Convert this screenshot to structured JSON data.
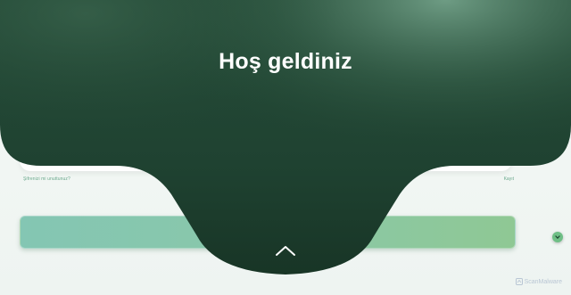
{
  "welcome": {
    "title": "Hoş geldiniz",
    "expand_icon": "chevron-up-icon"
  },
  "login": {
    "forgot_password": "Şifrenizi mi unuttunuz?",
    "signup": "Kayıt",
    "submit_label": ""
  },
  "help": {
    "icon": "chevron-down-icon"
  },
  "watermark": {
    "text": "ScanMalware"
  },
  "colors": {
    "sheet_dark": "#1f3f2e",
    "sheet_light": "#6f9a84",
    "button_start": "#84c6b3",
    "button_end": "#8fc894",
    "link": "#6aa88c",
    "badge": "#6fbf86"
  }
}
